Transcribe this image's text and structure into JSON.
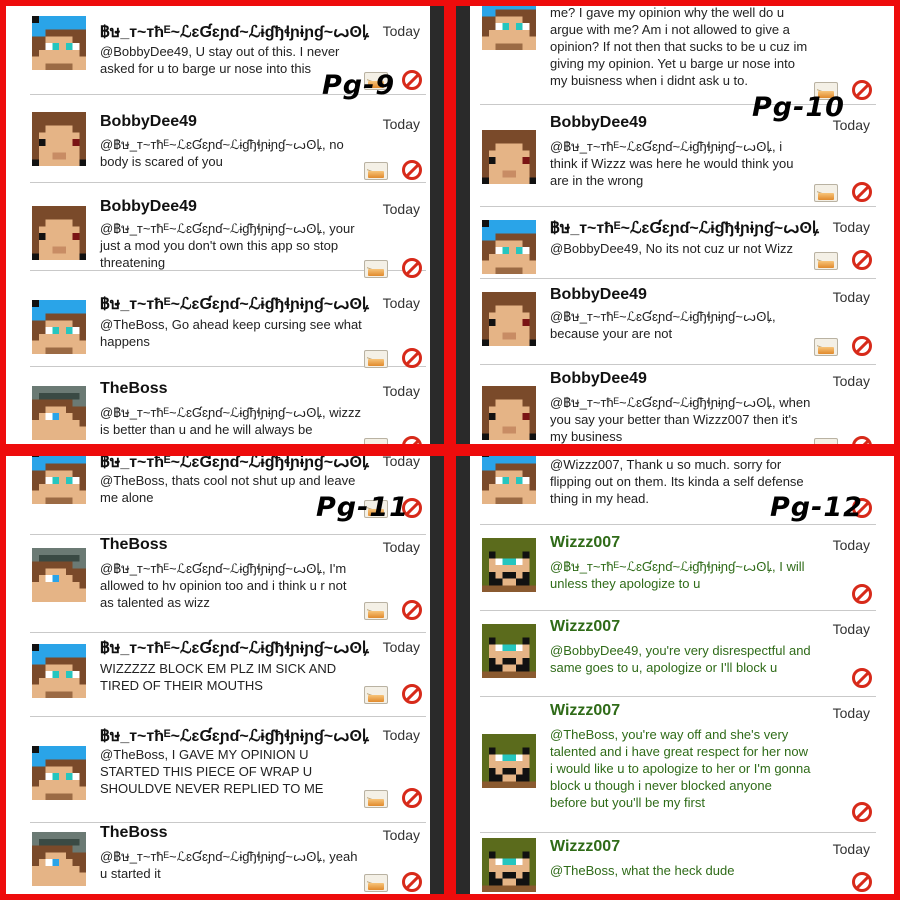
{
  "pages": [
    {
      "label": "Pg-9",
      "posts": [
        {
          "name": "฿ษ_т~тħᴱ~ℒɛƓɛɲɗ~ℒɨɠђɬɲɨɲɠ~ꙍʘꝲ",
          "time": "Today",
          "text": "@BobbyDee49, U stay out of this. I never asked for u to barge ur nose into this",
          "avatar": "wolf"
        },
        {
          "name": "BobbyDee49",
          "time": "Today",
          "text": "@฿ษ_т~тħᴱ~ℒɛƓɛɲɗ~ℒɨɠђɬɲɨɲɠ~ꙍʘꝲ, no body is scared of you",
          "avatar": "bobby"
        },
        {
          "name": "BobbyDee49",
          "time": "Today",
          "text": "@฿ษ_т~тħᴱ~ℒɛƓɛɲɗ~ℒɨɠђɬɲɨɲɠ~ꙍʘꝲ, your just a mod you don't own this app so stop threatening",
          "avatar": "bobby"
        },
        {
          "name": "฿ษ_т~тħᴱ~ℒɛƓɛɲɗ~ℒɨɠђɬɲɨɲɠ~ꙍʘꝲ",
          "time": "Today",
          "text": "@TheBoss, Go ahead keep cursing see what happens",
          "avatar": "wolf"
        },
        {
          "name": "TheBoss",
          "time": "Today",
          "text": "@฿ษ_т~тħᴱ~ℒɛƓɛɲɗ~ℒɨɠђɬɲɨɲɠ~ꙍʘꝲ, wizzz is better than u and he will always be",
          "avatar": "boss"
        }
      ]
    },
    {
      "label": "Pg-10",
      "posts": [
        {
          "name": "",
          "time": "",
          "text": "me? I gave my opinion why the well do u argue with me? Am i not allowed to give a opinion? If not then that sucks to be u cuz im giving my opinion. Yet u barge ur nose into my buisness when i didnt ask u to.",
          "avatar": "wolf"
        },
        {
          "name": "BobbyDee49",
          "time": "Today",
          "text": "@฿ษ_т~тħᴱ~ℒɛƓɛɲɗ~ℒɨɠђɬɲɨɲɠ~ꙍʘꝲ, i think if Wizzz was here he would think you are in the wrong",
          "avatar": "bobby"
        },
        {
          "name": "฿ษ_т~тħᴱ~ℒɛƓɛɲɗ~ℒɨɠђɬɲɨɲɠ~ꙍʘꝲ",
          "time": "Today",
          "text": "@BobbyDee49, No its not cuz ur not Wizz",
          "avatar": "wolf"
        },
        {
          "name": "BobbyDee49",
          "time": "Today",
          "text": "@฿ษ_т~тħᴱ~ℒɛƓɛɲɗ~ℒɨɠђɬɲɨɲɠ~ꙍʘꝲ, because your are not",
          "avatar": "bobby"
        },
        {
          "name": "BobbyDee49",
          "time": "Today",
          "text": "@฿ษ_т~тħᴱ~ℒɛƓɛɲɗ~ℒɨɠђɬɲɨɲɠ~ꙍʘꝲ, when you say your better than Wizzz007 then it's my business",
          "avatar": "bobby"
        }
      ]
    },
    {
      "label": "Pg-11",
      "posts": [
        {
          "name": "฿ษ_т~тħᴱ~ℒɛƓɛɲɗ~ℒɨɠђɬɲɨɲɠ~ꙍʘꝲ",
          "time": "Today",
          "text": "@TheBoss, thats cool not shut up and leave me alone",
          "avatar": "wolf"
        },
        {
          "name": "TheBoss",
          "time": "Today",
          "text": "@฿ษ_т~тħᴱ~ℒɛƓɛɲɗ~ℒɨɠђɬɲɨɲɠ~ꙍʘꝲ, I'm allowed to hv opinion too and i think u r not as talented as wizz",
          "avatar": "boss"
        },
        {
          "name": "฿ษ_т~тħᴱ~ℒɛƓɛɲɗ~ℒɨɠђɬɲɨɲɠ~ꙍʘꝲ",
          "time": "Today",
          "text": "WIZZZZZ BLOCK EM PLZ IM SICK AND TIRED OF THEIR MOUTHS",
          "avatar": "wolf"
        },
        {
          "name": "฿ษ_т~тħᴱ~ℒɛƓɛɲɗ~ℒɨɠђɬɲɨɲɠ~ꙍʘꝲ",
          "time": "Today",
          "text": "@TheBoss, I GAVE MY OPINION U STARTED THIS PIECE OF WRAP U SHOULDVE NEVER REPLIED TO ME",
          "avatar": "wolf"
        },
        {
          "name": "TheBoss",
          "time": "Today",
          "text": "@฿ษ_т~тħᴱ~ℒɛƓɛɲɗ~ℒɨɠђɬɲɨɲɠ~ꙍʘꝲ, yeah u started it",
          "avatar": "boss"
        }
      ]
    },
    {
      "label": "Pg-12",
      "posts": [
        {
          "name": "",
          "time": "",
          "text": "@Wizzz007, Thank u so much. sorry for flipping out on them. Its kinda a self defense thing in my head.",
          "avatar": "wolf"
        },
        {
          "name": "Wizzz007",
          "time": "Today",
          "text": "@฿ษ_т~тħᴱ~ℒɛƓɛɲɗ~ℒɨɠђɬɲɨɲɠ~ꙍʘꝲ, I will unless they apologize to u",
          "avatar": "wizzz"
        },
        {
          "name": "Wizzz007",
          "time": "Today",
          "text": "@BobbyDee49, you're very disrespectful and same goes to u, apologize or I'll block u",
          "avatar": "wizzz"
        },
        {
          "name": "Wizzz007",
          "time": "Today",
          "text": "@TheBoss, you're way off and she's very talented and i have great respect for her now i would like u to apologize to her or I'm gonna block u though i never blocked anyone before but you'll be my first",
          "avatar": "wizzz"
        },
        {
          "name": "Wizzz007",
          "time": "Today",
          "text": "@TheBoss, what the heck dude",
          "avatar": "wizzz"
        }
      ]
    }
  ]
}
